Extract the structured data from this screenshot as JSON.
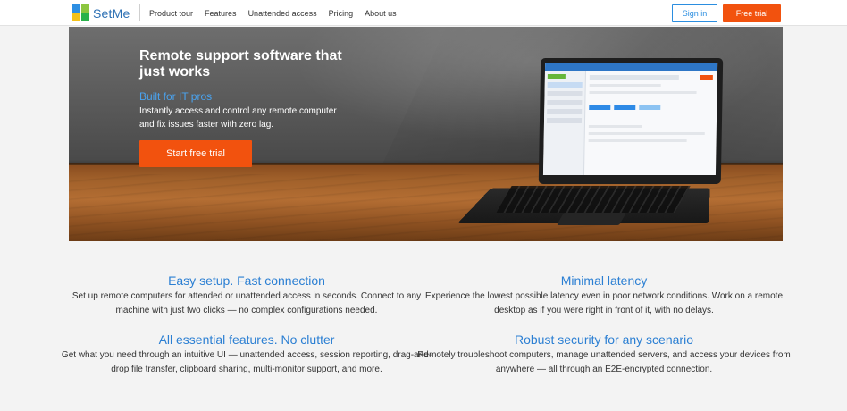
{
  "header": {
    "brand": "SetMe",
    "nav": [
      {
        "label": "Product tour"
      },
      {
        "label": "Features"
      },
      {
        "label": "Unattended access"
      },
      {
        "label": "Pricing"
      },
      {
        "label": "About us"
      }
    ],
    "signin_label": "Sign in",
    "free_trial_label": "Free trial",
    "colors": {
      "accent_blue": "#2b8ee0",
      "cta_orange": "#f2520e"
    }
  },
  "hero": {
    "title": "Remote support software that just works",
    "subtitle": "Built for IT pros",
    "description": "Instantly access and control any remote computer and fix issues faster with zero lag.",
    "cta_label": "Start free trial"
  },
  "features": [
    {
      "title": "Easy setup. Fast connection",
      "text": "Set up remote computers for attended or unattended access in seconds. Connect to any machine with just two clicks — no complex configurations needed."
    },
    {
      "title": "Minimal latency",
      "text": "Experience the lowest possible latency even in poor network conditions. Work on a remote desktop as if you were right in front of it, with no delays."
    },
    {
      "title": "All essential features. No clutter",
      "text": "Get what you need through an intuitive UI — unattended access, session reporting, drag-and-drop file transfer, clipboard sharing, multi-monitor support, and more."
    },
    {
      "title": "Robust security for any scenario",
      "text": "Remotely troubleshoot computers, manage unattended servers, and access your devices from anywhere — all through an E2E-encrypted connection."
    }
  ]
}
